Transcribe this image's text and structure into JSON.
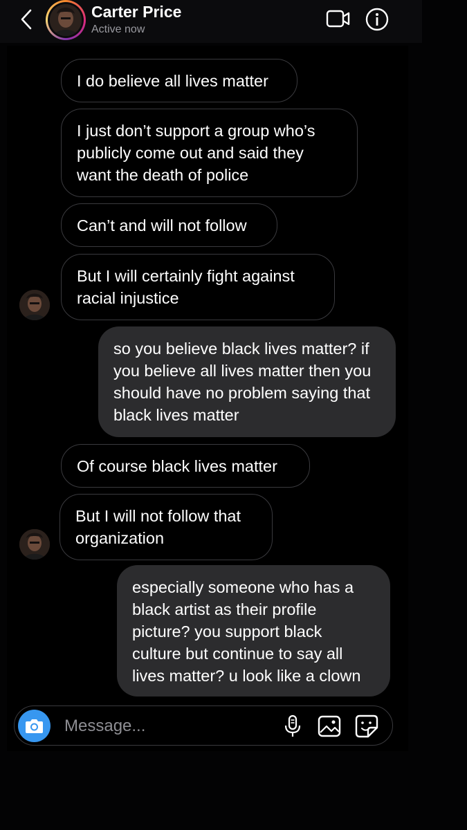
{
  "header": {
    "back_icon": "chevron-left-icon",
    "contact_name": "Carter Price",
    "status": "Active now",
    "video_icon": "video-camera-icon",
    "info_icon": "info-icon"
  },
  "messages": [
    {
      "direction": "incoming",
      "text": "I do believe all lives matter"
    },
    {
      "direction": "incoming",
      "text": "I just don’t support a group who’s publicly come out and said they want the death of police"
    },
    {
      "direction": "incoming",
      "text": "Can’t and will not follow"
    },
    {
      "direction": "incoming",
      "text": "But I will certainly fight against racial injustice"
    },
    {
      "direction": "outgoing",
      "text": "so you believe black lives matter? if you believe all lives matter then you should have no problem saying that black lives matter"
    },
    {
      "direction": "incoming",
      "text": "Of course black lives matter"
    },
    {
      "direction": "incoming",
      "text": "But I will not follow that organization"
    },
    {
      "direction": "outgoing",
      "text": "especially someone who has a black artist as their profile picture? you support black culture but continue to say all lives matter? u look like a clown"
    }
  ],
  "composer": {
    "placeholder": "Message...",
    "icons": [
      "camera-icon",
      "microphone-icon",
      "gallery-icon",
      "sticker-icon"
    ]
  },
  "colors": {
    "background": "#000000",
    "outgoing_bubble": "#2c2c2e",
    "incoming_border": "#3a3a3e",
    "camera_button": "#3797f0",
    "secondary_text": "#9a9aa0"
  }
}
